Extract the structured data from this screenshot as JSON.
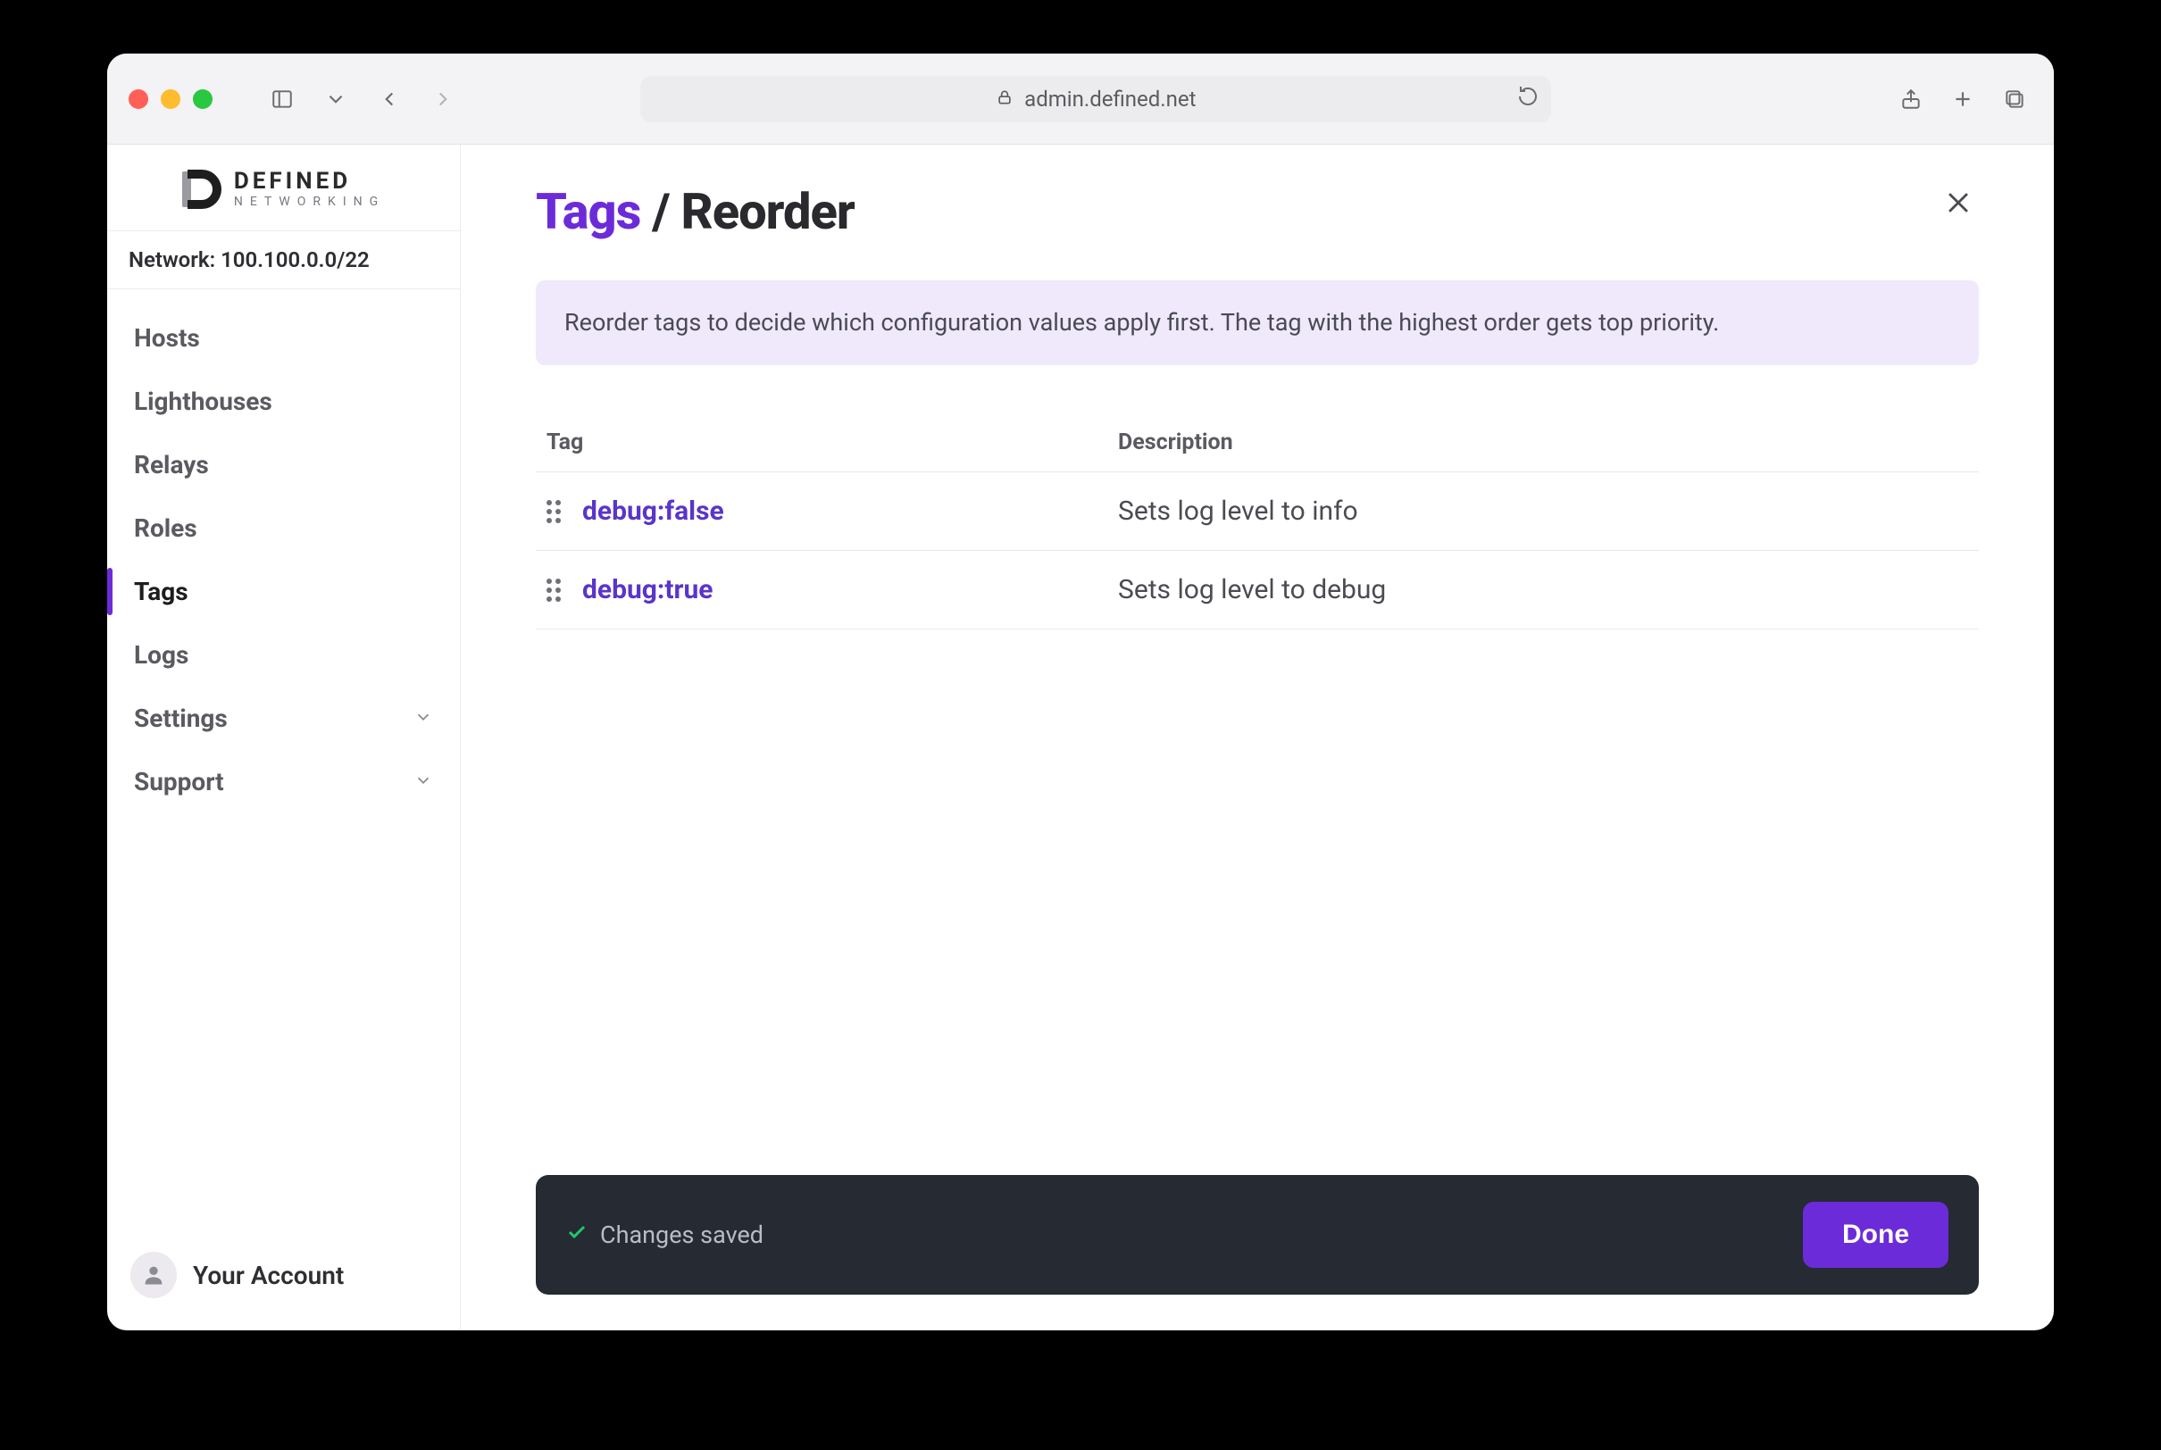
{
  "browser": {
    "url": "admin.defined.net"
  },
  "brand": {
    "line1": "DEFINED",
    "line2": "NETWORKING"
  },
  "network_label": "Network: 100.100.0.0/22",
  "sidebar": {
    "items": [
      {
        "label": "Hosts"
      },
      {
        "label": "Lighthouses"
      },
      {
        "label": "Relays"
      },
      {
        "label": "Roles"
      },
      {
        "label": "Tags"
      },
      {
        "label": "Logs"
      }
    ],
    "expandables": [
      {
        "label": "Settings"
      },
      {
        "label": "Support"
      }
    ],
    "active_index": 4,
    "account_label": "Your Account"
  },
  "page": {
    "breadcrumb_root": "Tags",
    "breadcrumb_sep": " / ",
    "breadcrumb_leaf": "Reorder",
    "banner": "Reorder tags to decide which configuration values apply first. The tag with the highest order gets top priority.",
    "columns": {
      "tag": "Tag",
      "desc": "Description"
    },
    "rows": [
      {
        "name": "debug:false",
        "desc": "Sets log level to info"
      },
      {
        "name": "debug:true",
        "desc": "Sets log level to debug"
      }
    ],
    "status_text": "Changes saved",
    "done_label": "Done"
  }
}
